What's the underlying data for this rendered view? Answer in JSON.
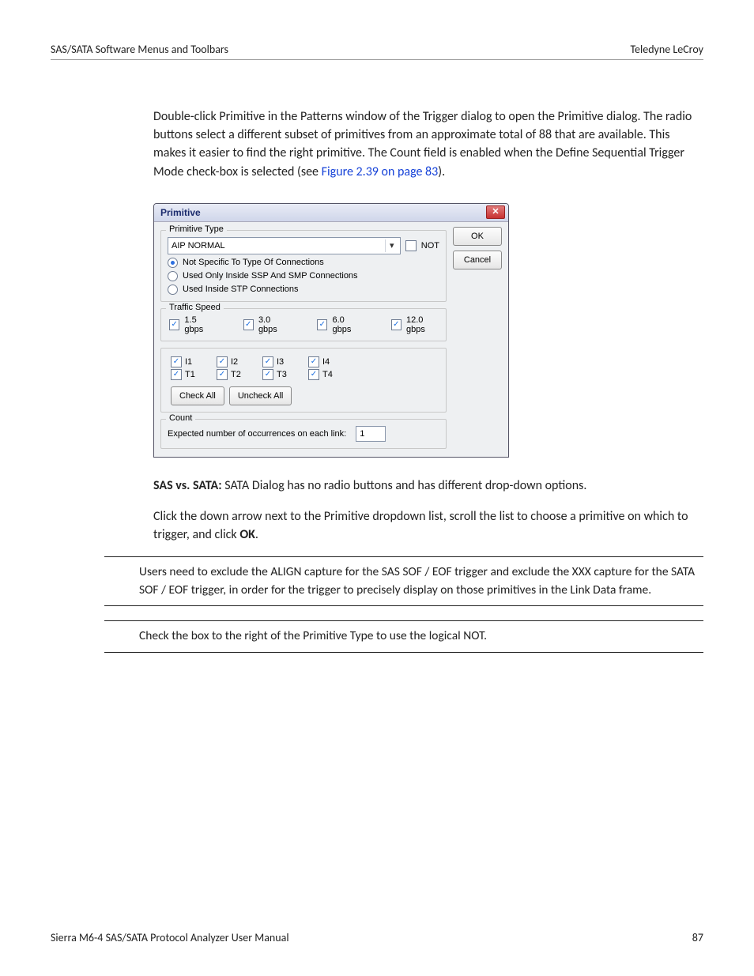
{
  "header": {
    "left": "SAS/SATA Software Menus and Toolbars",
    "right": "Teledyne LeCroy"
  },
  "para_intro": "Double-click Primitive in the Patterns window of the Trigger dialog to open the Primitive dialog. The radio buttons select a different subset of primitives from an approximate total of 88 that are available. This makes it easier to find the right primitive. The Count field is enabled when the Define Sequential Trigger Mode check-box is selected (see ",
  "xref": "Figure 2.39 on page 83",
  "para_intro_end": ").",
  "dialog": {
    "title": "Primitive",
    "ok": "OK",
    "cancel": "Cancel",
    "grp_primtype": "Primitive Type",
    "combo_value": "AIP NORMAL",
    "not_label": "NOT",
    "radios": {
      "r1": "Not Specific To Type Of Connections",
      "r2": "Used Only Inside SSP And SMP Connections",
      "r3": "Used Inside STP Connections"
    },
    "grp_speed": "Traffic Speed",
    "speeds": {
      "s1": "1.5 gbps",
      "s2": "3.0 gbps",
      "s3": "6.0 gbps",
      "s4": "12.0 gbps"
    },
    "ports_i": {
      "p1": "I1",
      "p2": "I2",
      "p3": "I3",
      "p4": "I4"
    },
    "ports_t": {
      "p1": "T1",
      "p2": "T2",
      "p3": "T3",
      "p4": "T4"
    },
    "check_all": "Check All",
    "uncheck_all": "Uncheck All",
    "grp_count": "Count",
    "count_label": "Expected number of occurrences on each link:",
    "count_value": "1"
  },
  "sas_sata_bold": "SAS vs. SATA:",
  "sas_sata_text": " SATA Dialog has no radio buttons and has different drop-down options.",
  "para_click": "Click the down arrow next to the Primitive dropdown list, scroll the list to choose a primitive on which to trigger, and click ",
  "ok_bold": "OK",
  "para_click_end": ".",
  "note1": "Users need to exclude the ALIGN capture for the SAS SOF / EOF trigger and exclude the XXX capture for the SATA SOF / EOF trigger, in order for the trigger to precisely display on those primitives in the Link Data frame.",
  "note2": "Check the box to the right of the Primitive Type to use the logical NOT.",
  "footer": {
    "left": "Sierra M6-4 SAS/SATA Protocol Analyzer User Manual",
    "right": "87"
  }
}
